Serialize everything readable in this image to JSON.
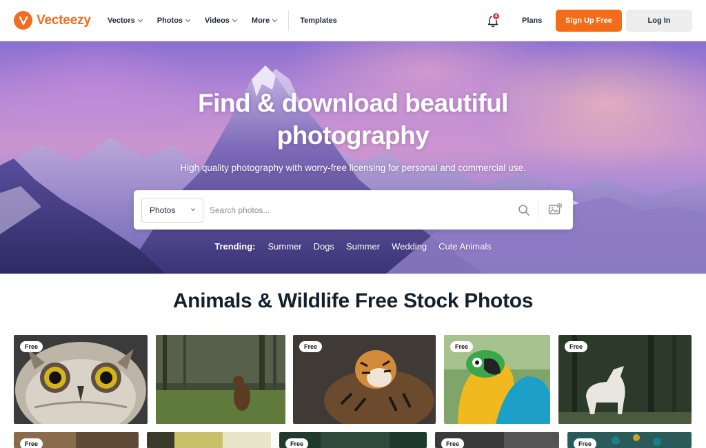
{
  "brand": {
    "name": "Vecteezy"
  },
  "nav": {
    "items": [
      {
        "label": "Vectors",
        "dropdown": true
      },
      {
        "label": "Photos",
        "dropdown": true
      },
      {
        "label": "Videos",
        "dropdown": true
      },
      {
        "label": "More",
        "dropdown": true
      }
    ],
    "templates": "Templates",
    "notifications_count": "4",
    "plans": "Plans",
    "signup": "Sign Up Free",
    "login": "Log In"
  },
  "hero": {
    "title_line1": "Find & download beautiful",
    "title_line2": "photography",
    "subtitle": "High quality photography with worry-free licensing for personal and commercial use.",
    "search": {
      "category": "Photos",
      "placeholder": "Search photos..."
    },
    "trending_label": "Trending:",
    "trending": [
      "Summer",
      "Dogs",
      "Summer",
      "Wedding",
      "Cute Animals"
    ]
  },
  "section": {
    "title": "Animals & Wildlife Free Stock Photos"
  },
  "photos": [
    {
      "subject": "owl",
      "badge": "Free"
    },
    {
      "subject": "bear",
      "badge": ""
    },
    {
      "subject": "tiger",
      "badge": "Free"
    },
    {
      "subject": "macaw",
      "badge": "Free"
    },
    {
      "subject": "wolf",
      "badge": "Free"
    },
    {
      "subject": "row2-1",
      "badge": "Free"
    },
    {
      "subject": "row2-2",
      "badge": ""
    },
    {
      "subject": "row2-3",
      "badge": "Free"
    },
    {
      "subject": "row2-4",
      "badge": "Free"
    },
    {
      "subject": "peacock",
      "badge": "Free"
    }
  ],
  "colors": {
    "brand": "#f26c22",
    "signup_bg": "#f26c1a",
    "login_bg": "#ededed",
    "badge": "#e53935"
  }
}
